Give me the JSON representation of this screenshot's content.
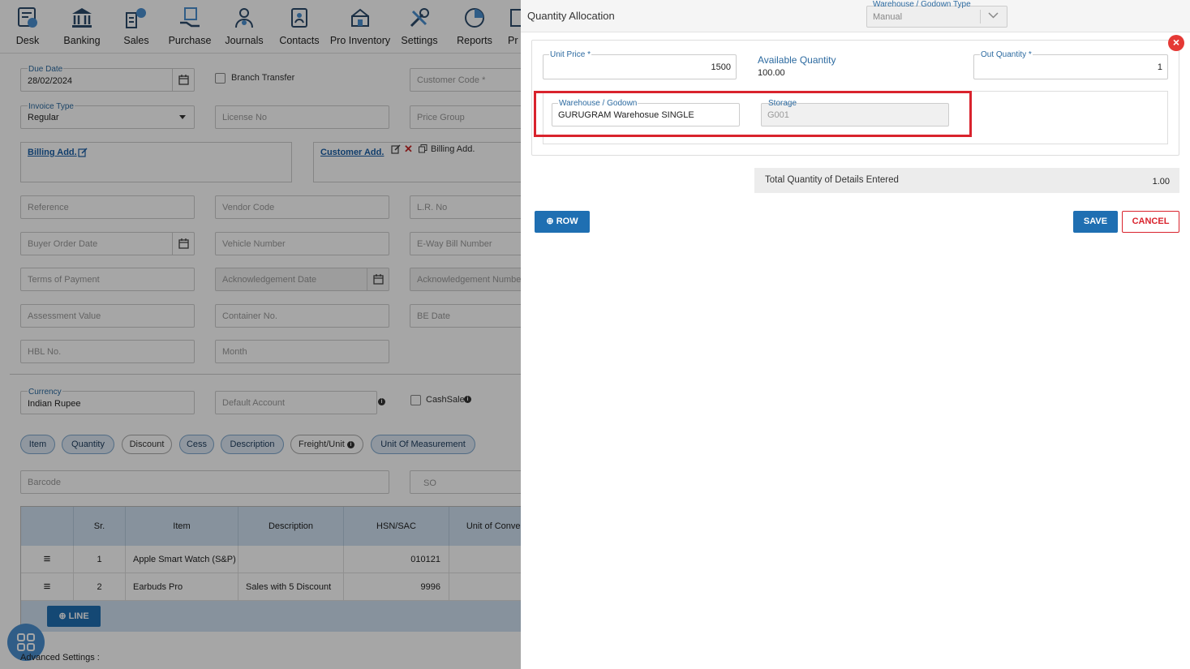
{
  "nav": [
    {
      "label": "Desk",
      "icon": "desk-icon"
    },
    {
      "label": "Banking",
      "icon": "bank-icon"
    },
    {
      "label": "Sales",
      "icon": "sales-icon"
    },
    {
      "label": "Purchase",
      "icon": "purchase-icon"
    },
    {
      "label": "Journals",
      "icon": "journals-icon"
    },
    {
      "label": "Contacts",
      "icon": "contacts-icon"
    },
    {
      "label": "Pro Inventory",
      "icon": "inventory-icon"
    },
    {
      "label": "Settings",
      "icon": "settings-icon"
    },
    {
      "label": "Reports",
      "icon": "reports-icon"
    },
    {
      "label": "Pr",
      "icon": "truncated-icon"
    }
  ],
  "form": {
    "due_date_label": "Due Date",
    "due_date": "28/02/2024",
    "branch_transfer": "Branch Transfer",
    "customer_code": "Customer Code *",
    "invoice_type_label": "Invoice Type",
    "invoice_type": "Regular",
    "license_no": "License No",
    "price_group": "Price Group",
    "billing_add": "Billing Add.",
    "customer_add": "Customer Add.",
    "billing_add_copy": "Billing Add.",
    "reference": "Reference",
    "vendor_code": "Vendor Code",
    "lr_no": "L.R. No",
    "buyer_order_date": "Buyer Order Date",
    "vehicle_number": "Vehicle Number",
    "eway_bill": "E-Way Bill Number",
    "terms_of_payment": "Terms of Payment",
    "ack_date": "Acknowledgement Date",
    "ack_number": "Acknowledgement Numbe",
    "assessment_value": "Assessment Value",
    "container_no": "Container No.",
    "be_date": "BE Date",
    "hbl_no": "HBL No.",
    "month": "Month",
    "currency_label": "Currency",
    "currency": "Indian Rupee",
    "default_account": "Default Account",
    "cashsale": "CashSale",
    "barcode": "Barcode",
    "so": "SO",
    "advanced_settings": "Advanced Settings :"
  },
  "chips": [
    {
      "label": "Item",
      "active": true
    },
    {
      "label": "Quantity",
      "active": true
    },
    {
      "label": "Discount",
      "active": false
    },
    {
      "label": "Cess",
      "active": true
    },
    {
      "label": "Description",
      "active": true
    },
    {
      "label": "Freight/Unit",
      "active": false
    },
    {
      "label": "Unit Of Measurement",
      "active": true
    }
  ],
  "grid": {
    "headers": [
      "",
      "Sr.",
      "Item",
      "Description",
      "HSN/SAC",
      "Unit of Conver"
    ],
    "rows": [
      {
        "sr": "1",
        "item": "Apple Smart Watch (S&P)",
        "description": "",
        "hsn": "010121"
      },
      {
        "sr": "2",
        "item": "Earbuds Pro",
        "description": "Sales with 5 Discount",
        "hsn": "9996"
      }
    ],
    "line_button": "LINE"
  },
  "modal": {
    "title": "Quantity Allocation",
    "wh_type_label": "Warehouse / Godown Type",
    "wh_type_value": "Manual",
    "unit_price_label": "Unit Price *",
    "unit_price": "1500",
    "available_label": "Available Quantity",
    "available_value": "100.00",
    "out_qty_label": "Out Quantity *",
    "out_qty": "1",
    "warehouse_label": "Warehouse / Godown",
    "warehouse_value": "GURUGRAM Warehosue SINGLE",
    "storage_label": "Storage",
    "storage_value": "G001",
    "total_label": "Total Quantity of Details Entered",
    "total_value": "1.00",
    "row_button": "ROW",
    "save_button": "SAVE",
    "cancel_button": "CANCEL",
    "close_glyph": "×"
  },
  "colors": {
    "primary": "#1f6fb2",
    "danger": "#d9232d",
    "label_blue": "#2c6aa0"
  }
}
